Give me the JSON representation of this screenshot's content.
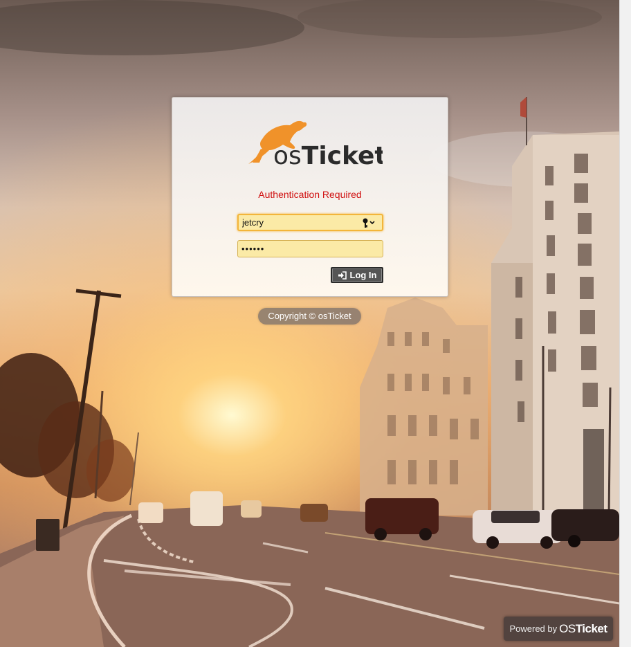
{
  "login": {
    "auth_message": "Authentication Required",
    "username_value": "jetcry",
    "password_mask": "••••••",
    "login_button_label": "Log In"
  },
  "logo": {
    "text_os": "os",
    "text_ticket": "Ticket",
    "icon": "kangaroo-logo"
  },
  "footer": {
    "copyright": "Copyright © osTicket",
    "powered_by": "Powered by",
    "powered_brand_os": "OS",
    "powered_brand_ticket": "Ticket"
  },
  "colors": {
    "auth_message": "#d01010",
    "input_bg": "#fbeaa6",
    "logo_orange": "#f0922a",
    "logo_dark": "#2b2b2b",
    "button_bg": "#555555"
  }
}
